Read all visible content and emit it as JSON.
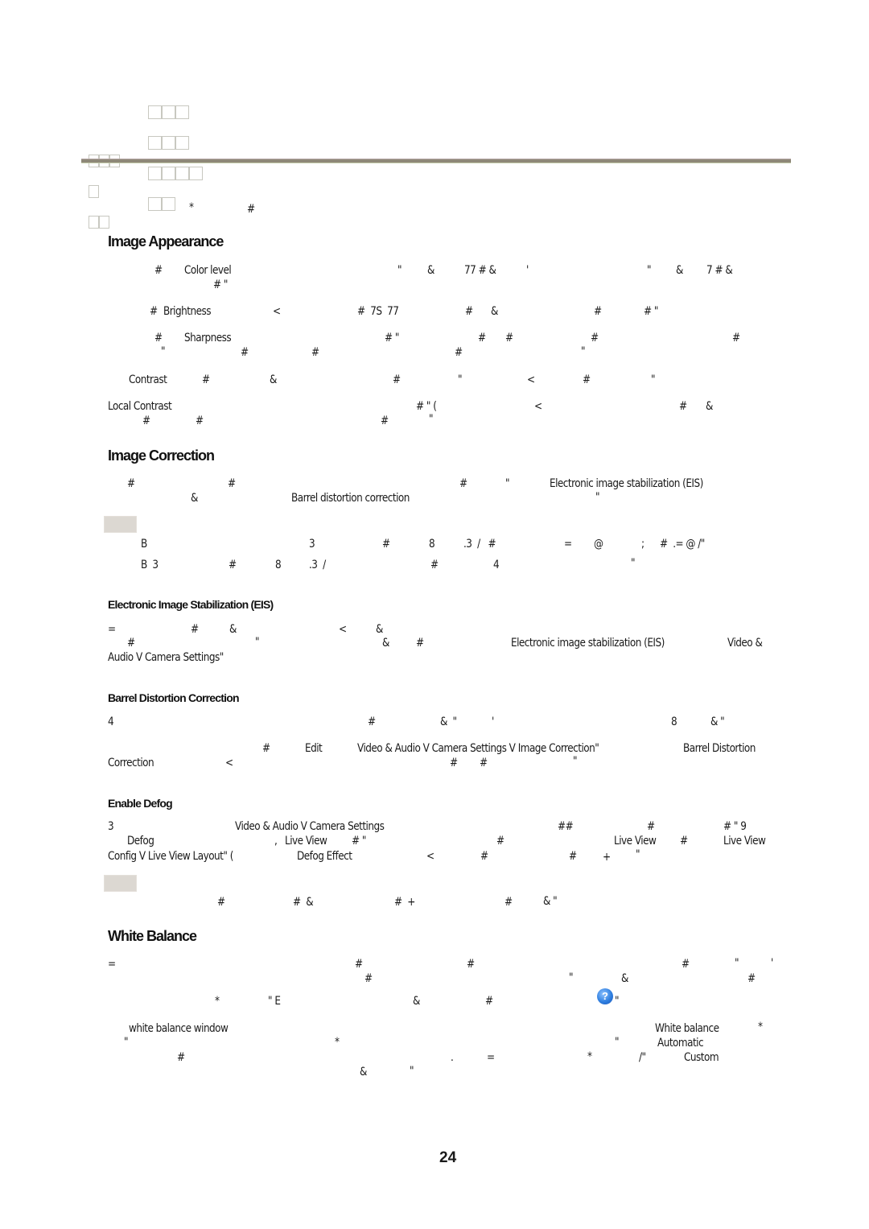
{
  "header": {
    "title_glyph_groups": [
      3,
      3,
      4,
      2
    ],
    "subtitle_glyph_groups": [
      3,
      1,
      2
    ]
  },
  "intro": {
    "fragments": [
      "*",
      "#"
    ]
  },
  "sections": {
    "image_appearance": {
      "heading": "Image Appearance",
      "color_level": {
        "label": "Color level",
        "line1": [
          "#",
          "\"",
          "&",
          "77 # &",
          "'",
          "\"",
          "&",
          "7 # &"
        ],
        "line2": "# \""
      },
      "brightness": {
        "label": "Brightness",
        "line": [
          "#",
          "<",
          "#  7S  77",
          "#",
          "&",
          "#",
          "# \""
        ]
      },
      "sharpness": {
        "label": "Sharpness",
        "line1": [
          "#",
          "# \"",
          "#",
          "#",
          "#",
          "#"
        ],
        "line2": [
          "\"",
          "#",
          "#",
          "#",
          "\""
        ]
      },
      "contrast": {
        "label": "Contrast",
        "line": [
          "#",
          "&",
          "#",
          "\"",
          "<",
          "#",
          "\""
        ]
      },
      "local_contrast": {
        "label": "Local Contrast",
        "line1": [
          "# \" (",
          "<",
          "#",
          "&"
        ],
        "line2": [
          "#",
          "#",
          "#",
          "\""
        ]
      }
    },
    "image_correction": {
      "heading": "Image Correction",
      "line1": [
        "#",
        "#",
        "#",
        "\""
      ],
      "eis_label": "Electronic image stabilization (EIS)",
      "line2_amp": "&",
      "barrel_label": "Barrel distortion correction",
      "line2_end": "\"",
      "note_line1": [
        "B",
        "3",
        "#",
        "8",
        ".3  /   #",
        "=",
        "@",
        ";",
        "#  .= @ /\""
      ],
      "note_line2": [
        "B  3",
        "#",
        "8",
        ".3  /",
        "#",
        "4",
        "\""
      ]
    },
    "eis": {
      "heading": "Electronic Image Stabilization (EIS)",
      "line1": [
        "=",
        "#",
        "&",
        "<",
        "&"
      ],
      "line2": [
        "#",
        "\"",
        "&",
        "#"
      ],
      "eis_label": "Electronic image stabilization (EIS)",
      "path_part1": "Video &",
      "path_part2": "Audio V Camera Settings\""
    },
    "barrel": {
      "heading": "Barrel Distortion Correction",
      "line1": [
        "4",
        "#",
        "&  \"",
        "'",
        "8",
        "& \""
      ],
      "line2_hash": "#",
      "edit_label": "Edit",
      "path": "Video & Audio V Camera Settings V Image Correction\"",
      "bdc_label_part1": "Barrel Distortion",
      "bdc_label_part2": "Correction",
      "line3": [
        "<",
        "#",
        "#",
        "\""
      ]
    },
    "defog": {
      "heading": "Enable Defog",
      "line1_start": "3",
      "path": "Video & Audio V Camera Settings",
      "line1_rest": [
        "##",
        "#",
        "# \" 9"
      ],
      "defog_label": "Defog",
      "comma": ",",
      "live_view_1": "Live View",
      "line2_mid": [
        "# \"",
        "#"
      ],
      "live_view_2": "Live View",
      "line2_hash": "#",
      "live_view_3": "Live View",
      "config_path": "Config V Live View Layout\" (",
      "defog_effect": "Defog Effect",
      "line3_rest": [
        "<",
        "#",
        "#",
        "+",
        "\""
      ],
      "note_line": [
        "#",
        "#  &",
        "#  +",
        "#",
        "& \""
      ]
    },
    "white_balance": {
      "heading": "White Balance",
      "line1": [
        "=",
        "#",
        "#",
        "#",
        "\"",
        "'"
      ],
      "line2": [
        "#",
        "\"",
        "&",
        "#"
      ],
      "line3": [
        "*",
        "\" E",
        "&",
        "#"
      ],
      "help_icon_glyph": "?",
      "line3_end": "\"",
      "wb_window": "white balance window",
      "wb_label": "White balance",
      "star": "*",
      "line5": [
        "\"",
        "*",
        "\""
      ],
      "automatic": "Automatic",
      "line6": [
        "#",
        ".",
        "=",
        "*",
        "/\""
      ],
      "custom": "Custom",
      "line7": [
        "&",
        "\""
      ]
    }
  },
  "footer": {
    "page_number": "24"
  }
}
